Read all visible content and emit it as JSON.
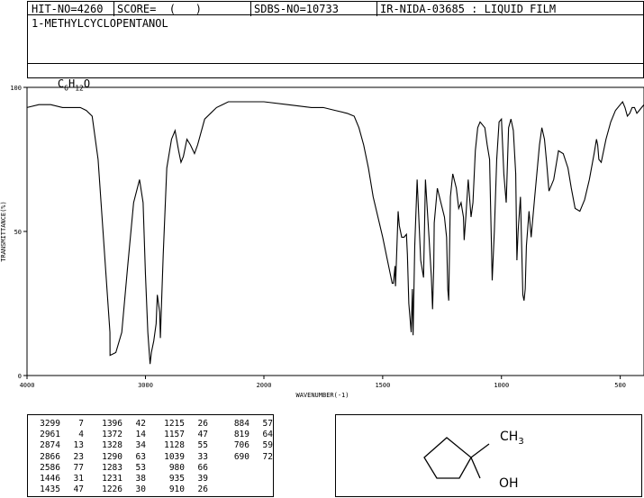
{
  "header": {
    "hit_no": "HIT-NO=4260",
    "score": "SCORE=  (   )",
    "sdbs_no": "SDBS-NO=10733",
    "ir_nida": "IR-NIDA-03685 : LIQUID FILM"
  },
  "compound_name": "1-METHYLCYCLOPENTANOL",
  "formula": {
    "c": "C",
    "c_sub": "6",
    "h": "H",
    "h_sub": "12",
    "o": "O"
  },
  "chart_data": {
    "type": "line",
    "xlabel": "WAVENUMBER(-1)",
    "ylabel": "TRANSMITTANCE(%)",
    "xlim": [
      4000,
      400
    ],
    "ylim": [
      0,
      100
    ],
    "x_ticks": [
      4000,
      3000,
      2000,
      1500,
      1000,
      500
    ],
    "y_ticks": [
      0,
      50,
      100
    ],
    "x": [
      4000,
      3900,
      3800,
      3700,
      3600,
      3550,
      3500,
      3450,
      3400,
      3350,
      3300,
      3299,
      3250,
      3200,
      3150,
      3100,
      3050,
      3020,
      3000,
      2980,
      2961,
      2950,
      2930,
      2910,
      2900,
      2880,
      2874,
      2866,
      2850,
      2820,
      2780,
      2750,
      2720,
      2700,
      2680,
      2650,
      2620,
      2586,
      2560,
      2500,
      2450,
      2400,
      2350,
      2300,
      2200,
      2100,
      2000,
      1900,
      1800,
      1750,
      1700,
      1650,
      1620,
      1600,
      1580,
      1560,
      1540,
      1520,
      1500,
      1480,
      1470,
      1460,
      1455,
      1448,
      1446,
      1440,
      1435,
      1430,
      1420,
      1410,
      1400,
      1396,
      1390,
      1380,
      1375,
      1372,
      1365,
      1355,
      1340,
      1328,
      1320,
      1305,
      1295,
      1290,
      1285,
      1283,
      1270,
      1255,
      1240,
      1231,
      1226,
      1222,
      1215,
      1205,
      1190,
      1180,
      1170,
      1160,
      1157,
      1150,
      1140,
      1128,
      1120,
      1110,
      1100,
      1090,
      1070,
      1060,
      1050,
      1039,
      1030,
      1020,
      1010,
      1000,
      990,
      980,
      970,
      960,
      950,
      940,
      935,
      930,
      920,
      910,
      905,
      900,
      895,
      884,
      875,
      860,
      840,
      830,
      819,
      810,
      800,
      780,
      760,
      740,
      720,
      706,
      690,
      670,
      650,
      630,
      610,
      600,
      595,
      590,
      580,
      560,
      540,
      520,
      500,
      490,
      480,
      470,
      460,
      450,
      440,
      430,
      420,
      410,
      400
    ],
    "y": [
      93,
      94,
      94,
      93,
      93,
      93,
      92,
      90,
      75,
      45,
      15,
      7,
      8,
      15,
      38,
      60,
      68,
      60,
      35,
      15,
      4,
      8,
      12,
      18,
      28,
      22,
      13,
      23,
      42,
      72,
      82,
      85,
      78,
      74,
      76,
      82,
      80,
      77,
      80,
      89,
      91,
      93,
      94,
      95,
      95,
      95,
      95,
      94,
      93,
      93,
      92,
      91,
      90,
      86,
      80,
      72,
      62,
      55,
      48,
      40,
      36,
      32,
      32,
      38,
      31,
      45,
      57,
      52,
      48,
      48,
      49,
      42,
      25,
      15,
      30,
      14,
      45,
      68,
      40,
      34,
      68,
      48,
      34,
      23,
      38,
      53,
      65,
      60,
      55,
      48,
      30,
      26,
      62,
      70,
      65,
      58,
      60,
      55,
      47,
      55,
      68,
      55,
      60,
      78,
      86,
      88,
      86,
      80,
      75,
      33,
      50,
      75,
      88,
      89,
      70,
      60,
      86,
      89,
      85,
      70,
      40,
      50,
      62,
      28,
      26,
      30,
      45,
      57,
      48,
      62,
      80,
      86,
      82,
      74,
      64,
      68,
      78,
      77,
      72,
      65,
      58,
      57,
      61,
      68,
      77,
      82,
      80,
      75,
      74,
      82,
      88,
      92,
      94,
      95,
      93,
      90,
      91,
      93,
      93,
      91,
      92,
      93,
      94,
      95
    ]
  },
  "peaks": {
    "col1": [
      [
        "3299",
        "7"
      ],
      [
        "2961",
        "4"
      ],
      [
        "2874",
        "13"
      ],
      [
        "2866",
        "23"
      ],
      [
        "2586",
        "77"
      ],
      [
        "1446",
        "31"
      ],
      [
        "1435",
        "47"
      ]
    ],
    "col2": [
      [
        "1396",
        "42"
      ],
      [
        "1372",
        "14"
      ],
      [
        "1328",
        "34"
      ],
      [
        "1290",
        "63"
      ],
      [
        "1283",
        "53"
      ],
      [
        "1231",
        "38"
      ],
      [
        "1226",
        "30"
      ]
    ],
    "col3": [
      [
        "1215",
        "26"
      ],
      [
        "1157",
        "47"
      ],
      [
        "1128",
        "55"
      ],
      [
        "1039",
        "33"
      ],
      [
        "980",
        "66"
      ],
      [
        "935",
        "39"
      ],
      [
        "910",
        "26"
      ]
    ],
    "col4": [
      [
        "884",
        "57"
      ],
      [
        "819",
        "64"
      ],
      [
        "706",
        "59"
      ],
      [
        "690",
        "72"
      ]
    ]
  },
  "structure": {
    "methyl_label": "CH3",
    "methyl_main": "CH",
    "methyl_sub": "3",
    "hydroxyl_label": "OH"
  }
}
